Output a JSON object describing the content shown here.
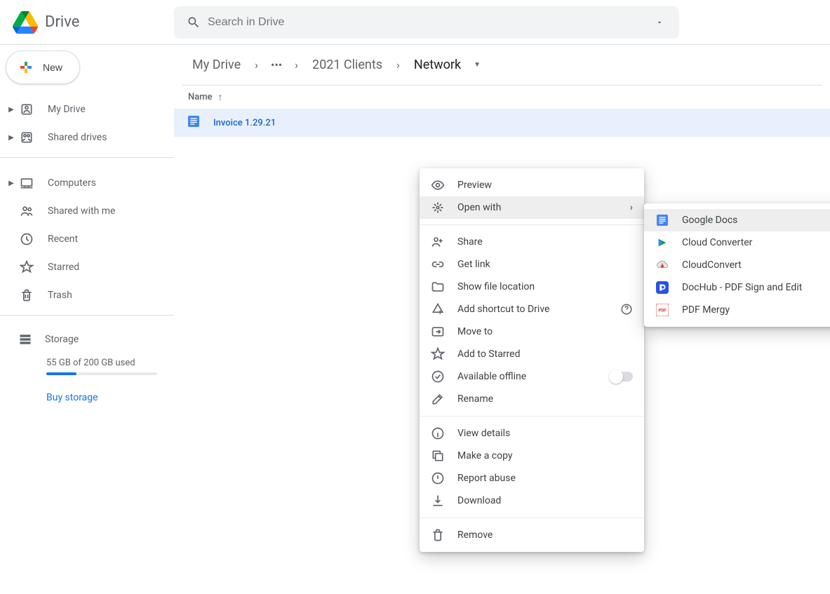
{
  "app": {
    "name": "Drive"
  },
  "search": {
    "placeholder": "Search in Drive"
  },
  "sidebar": {
    "new_btn": "New",
    "items": [
      {
        "label": "My Drive",
        "expandable": true
      },
      {
        "label": "Shared drives",
        "expandable": true
      }
    ],
    "items2": [
      {
        "label": "Computers",
        "expandable": true
      },
      {
        "label": "Shared with me",
        "expandable": false
      },
      {
        "label": "Recent",
        "expandable": false
      },
      {
        "label": "Starred",
        "expandable": false
      },
      {
        "label": "Trash",
        "expandable": false
      }
    ],
    "storage": {
      "heading": "Storage",
      "used_text": "55 GB of 200 GB used",
      "buy": "Buy storage"
    }
  },
  "breadcrumb": {
    "root": "My Drive",
    "mid": "2021 Clients",
    "current": "Network"
  },
  "column_header": "Name",
  "file": {
    "name": "Invoice 1.29.21"
  },
  "context_menu": {
    "preview": "Preview",
    "open_with": "Open with",
    "share": "Share",
    "get_link": "Get link",
    "show_location": "Show file location",
    "add_shortcut": "Add shortcut to Drive",
    "move_to": "Move to",
    "add_starred": "Add to Starred",
    "offline": "Available offline",
    "rename": "Rename",
    "view_details": "View details",
    "make_copy": "Make a copy",
    "report_abuse": "Report abuse",
    "download": "Download",
    "remove": "Remove"
  },
  "open_with_apps": [
    {
      "label": "Google Docs"
    },
    {
      "label": "Cloud Converter"
    },
    {
      "label": "CloudConvert"
    },
    {
      "label": "DocHub - PDF Sign and Edit"
    },
    {
      "label": "PDF Mergy"
    }
  ]
}
